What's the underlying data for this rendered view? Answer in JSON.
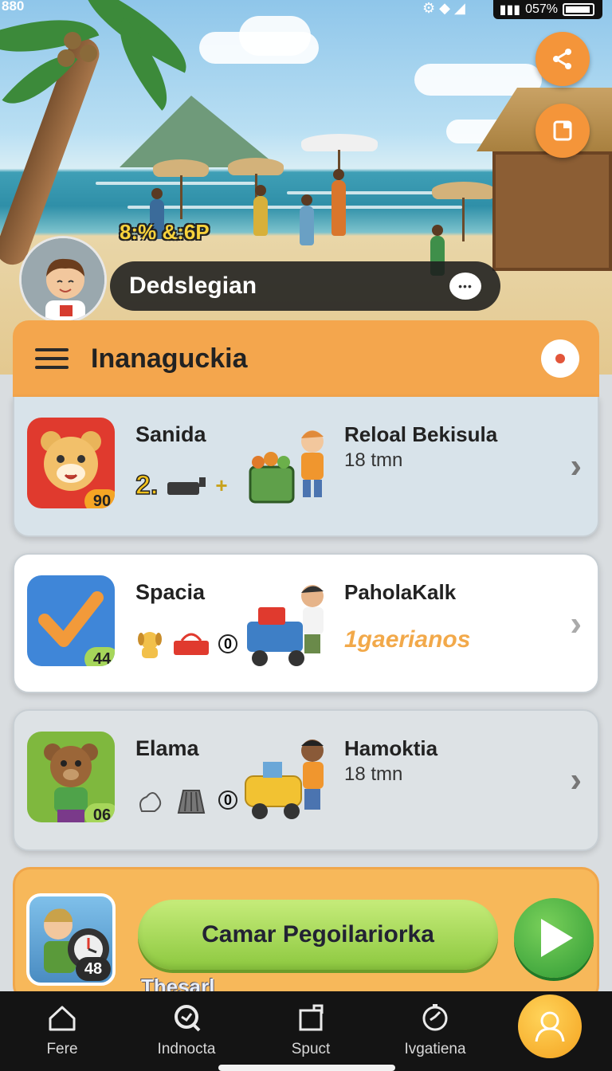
{
  "status_bar": {
    "time": "880",
    "battery": "057%"
  },
  "hero": {
    "time_display": "8:% &:6P",
    "user_name": "Dedslegian"
  },
  "fab_icons": [
    "share-icon",
    "note-icon"
  ],
  "panel": {
    "title": "Inanaguckia"
  },
  "cards": [
    {
      "label": "Sanida",
      "badge": "90",
      "items_prefix": "2.",
      "items_suffix": "+",
      "destination": "Reloal Bekisula",
      "subtitle": "18 tmn",
      "icon_color": "#e03a2e",
      "badge_color": "#f5a524"
    },
    {
      "label": "Spacia",
      "badge": "44",
      "items_suffix": "0",
      "destination": "PaholaKalk",
      "subtitle": "1gaerianos",
      "icon_color": "#3f86d8",
      "badge_color": "#a6d65a"
    },
    {
      "label": "Elama",
      "badge": "06",
      "items_suffix": "0",
      "destination": "Hamoktia",
      "subtitle": "18 tmn",
      "icon_color": "#7fb83e",
      "badge_color": "#a6d65a"
    }
  ],
  "action": {
    "button_label": "Camar Pegoilariorka",
    "badge": "48",
    "sub_label": "Thesarl"
  },
  "nav": [
    {
      "label": "Fere",
      "icon": "home-icon"
    },
    {
      "label": "Indnocta",
      "icon": "search-icon"
    },
    {
      "label": "Spuct",
      "icon": "box-icon"
    },
    {
      "label": "Ivgatiena",
      "icon": "compass-icon"
    }
  ],
  "colors": {
    "accent": "#f4a64d",
    "primary_button": "#8cc83f",
    "nav_bg": "#141414"
  }
}
